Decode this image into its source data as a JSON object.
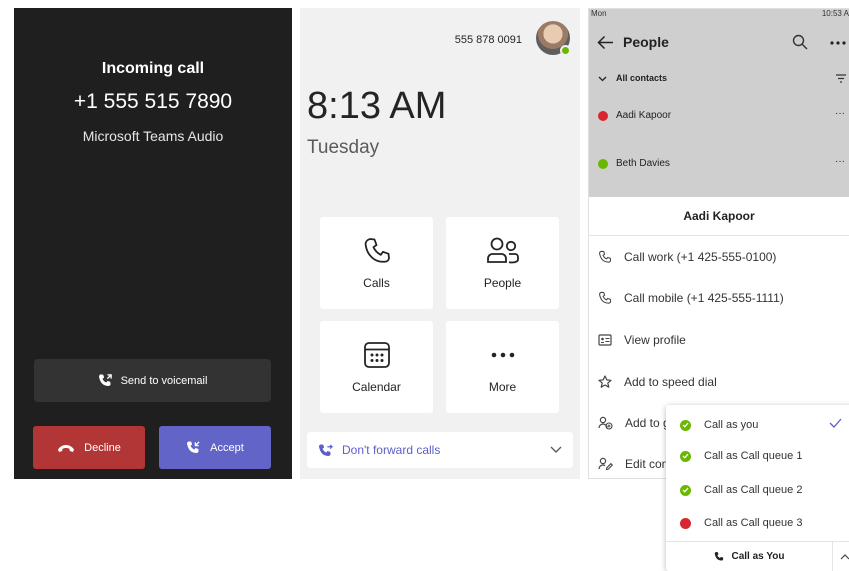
{
  "incoming_call": {
    "title": "Incoming call",
    "number": "+1 555 515 7890",
    "subtitle": "Microsoft Teams Audio",
    "voicemail_label": "Send to voicemail",
    "decline_label": "Decline",
    "accept_label": "Accept",
    "colors": {
      "background": "#1f1f1f",
      "decline": "#b33636",
      "accept": "#6264c7"
    }
  },
  "home": {
    "phone_number": "555 878 0091",
    "time": "8:13 AM",
    "day": "Tuesday",
    "tiles": [
      {
        "label": "Calls",
        "icon": "phone-icon"
      },
      {
        "label": "People",
        "icon": "people-icon"
      },
      {
        "label": "Calendar",
        "icon": "calendar-icon"
      },
      {
        "label": "More",
        "icon": "more-dots-icon"
      }
    ],
    "forward_label": "Don't forward calls",
    "presence_color": "#6bb700"
  },
  "people": {
    "status_left": "Mon",
    "status_time": "10:53 A",
    "title": "People",
    "group_label": "All contacts",
    "contacts": [
      {
        "name": "Aadi Kapoor",
        "presence": "busy"
      },
      {
        "name": "Beth Davies",
        "presence": "available"
      }
    ],
    "sheet": {
      "title": "Aadi Kapoor",
      "items": [
        "Call work (+1 425-555-0100)",
        "Call mobile (+1 425-555-1111)",
        "View profile",
        "Add to speed dial",
        "Add to g",
        "Edit con"
      ]
    }
  },
  "call_as_menu": {
    "options": [
      {
        "label": "Call as you",
        "status": "available",
        "selected": true
      },
      {
        "label": "Call as Call queue 1",
        "status": "available",
        "selected": false
      },
      {
        "label": "Call as Call queue 2",
        "status": "available",
        "selected": false
      },
      {
        "label": "Call as Call queue 3",
        "status": "busy",
        "selected": false
      }
    ],
    "footer_label": "Call as You",
    "colors": {
      "available": "#6bb700",
      "busy": "#d9252f",
      "check": "#5b5fc7"
    }
  }
}
